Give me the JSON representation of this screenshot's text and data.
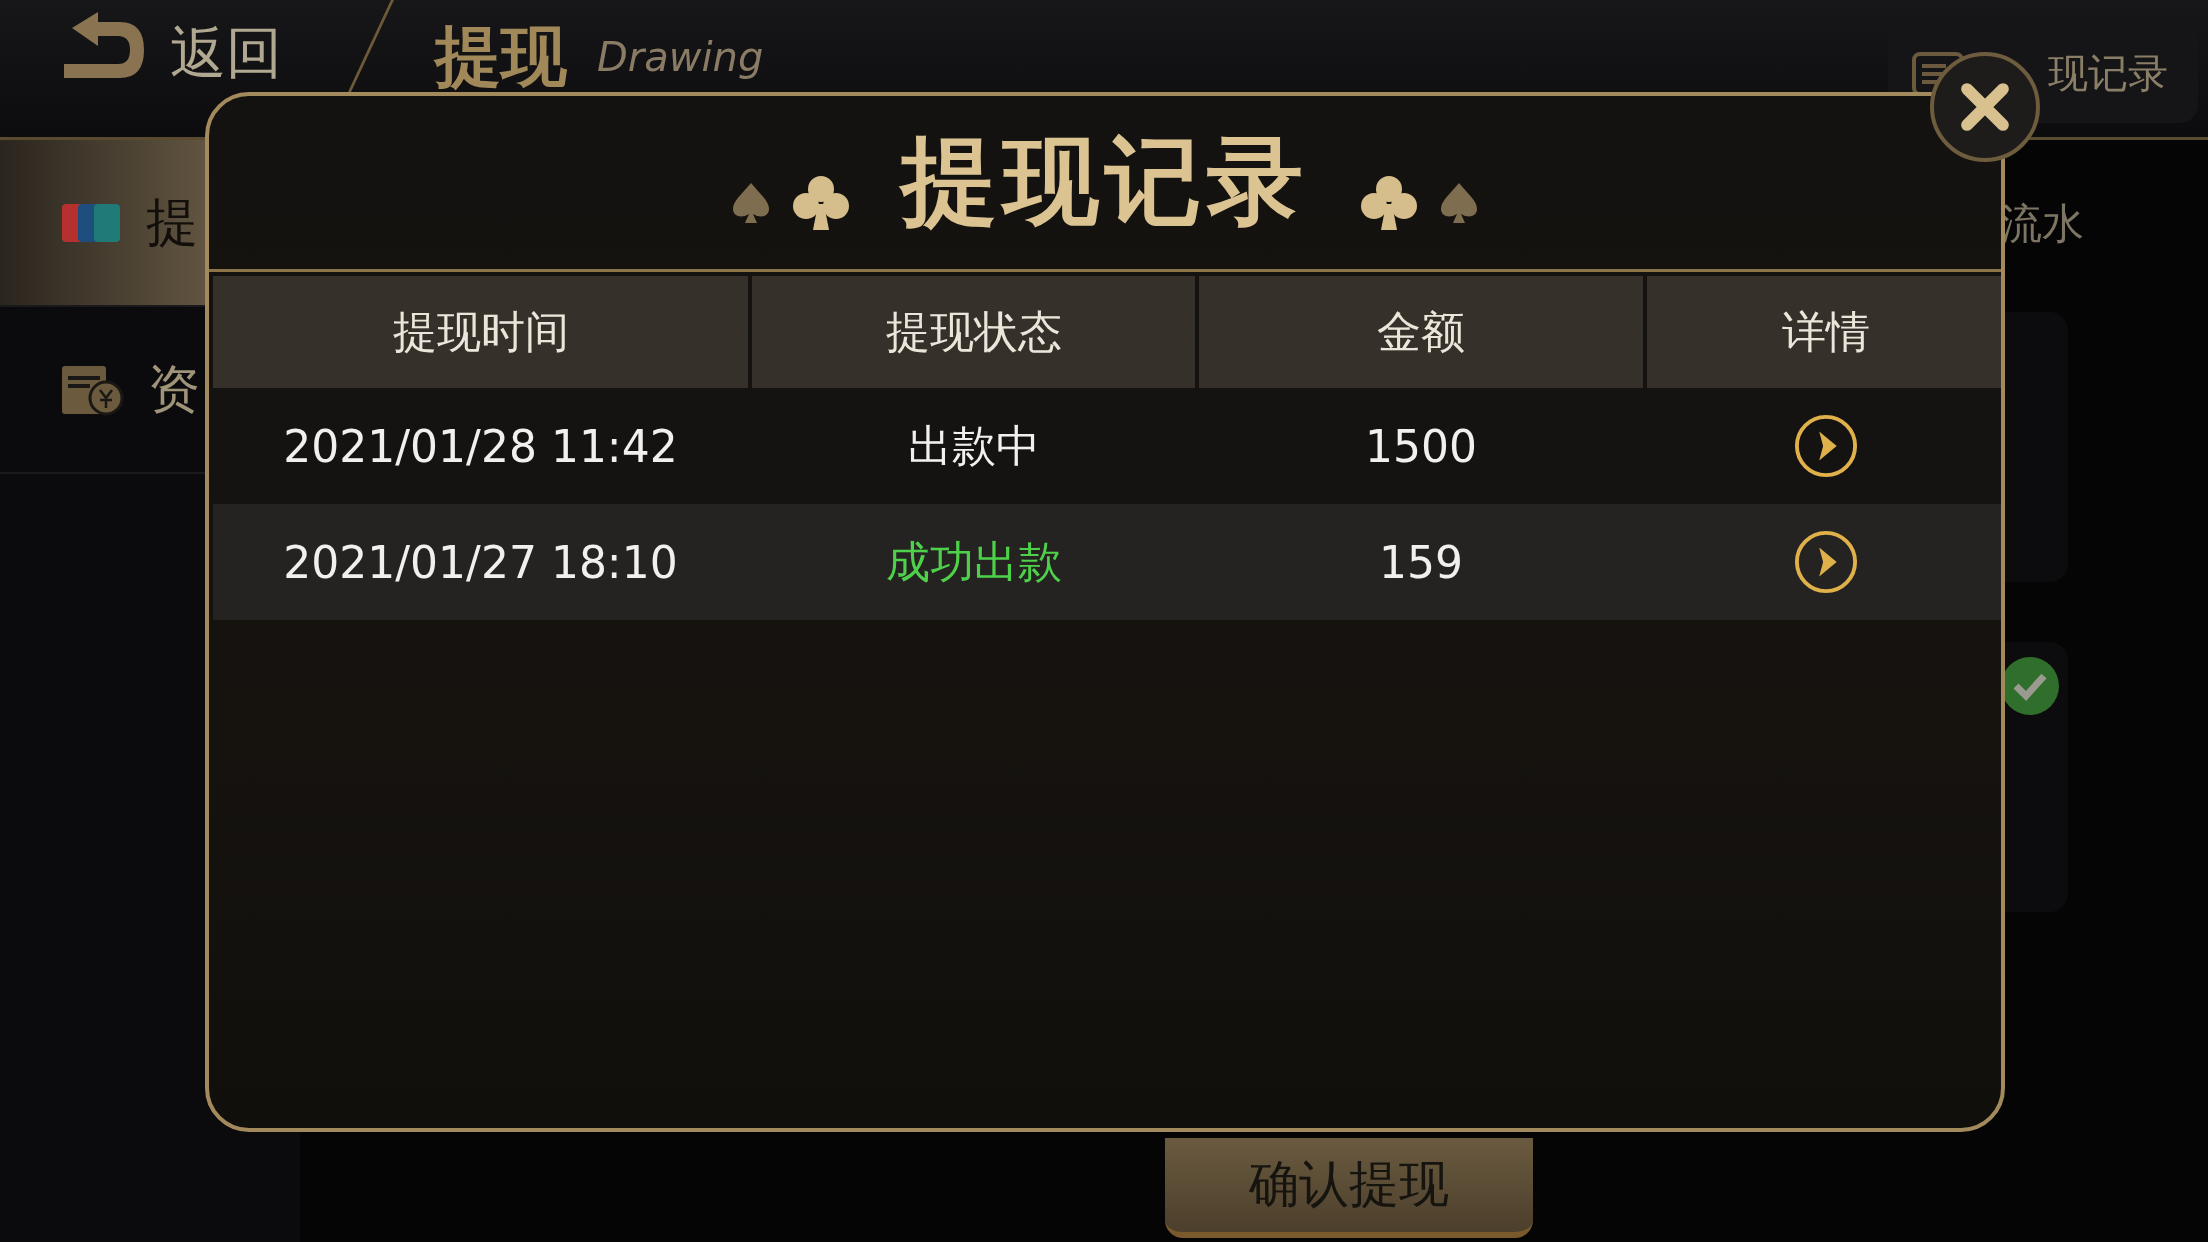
{
  "header": {
    "back_label": "返回",
    "title": "提现",
    "subtitle": "Drawing",
    "record_button": "现记录"
  },
  "sidebar": {
    "items": [
      {
        "label": "提",
        "selected": true,
        "kind": "card"
      },
      {
        "label": "资",
        "selected": false,
        "kind": "wallet"
      }
    ]
  },
  "content": {
    "tab_label": "流水",
    "confirm_button": "确认提现",
    "verified": true
  },
  "dialog": {
    "title": "提现记录",
    "columns": [
      "提现时间",
      "提现状态",
      "金额",
      "详情"
    ],
    "rows": [
      {
        "time": "2021/01/28 11:42",
        "status": "出款中",
        "kind": "pending",
        "amount": "1500"
      },
      {
        "time": "2021/01/27 18:10",
        "status": "成功出款",
        "kind": "success",
        "amount": "159"
      }
    ]
  }
}
